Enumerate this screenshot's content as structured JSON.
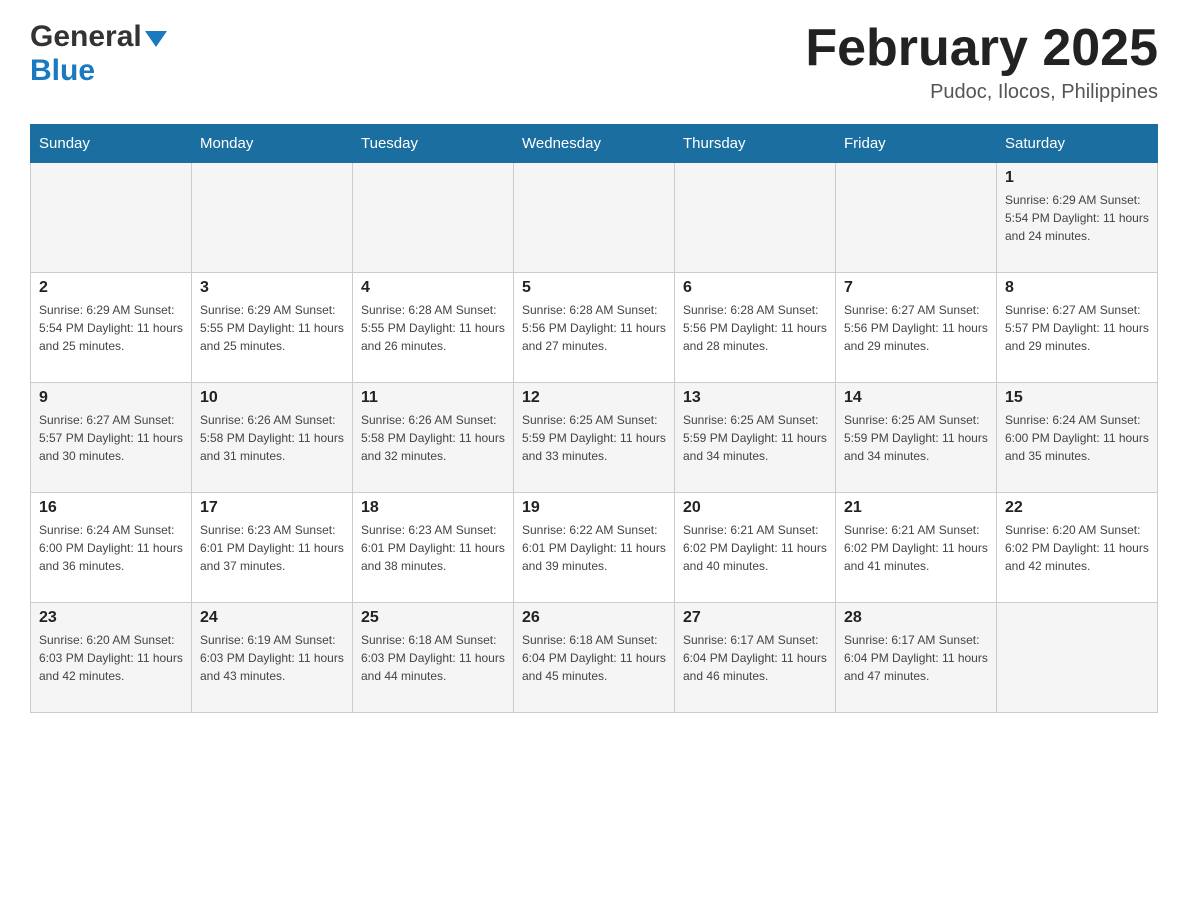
{
  "header": {
    "logo_general": "General",
    "logo_blue": "Blue",
    "month_title": "February 2025",
    "location": "Pudoc, Ilocos, Philippines"
  },
  "days_of_week": [
    "Sunday",
    "Monday",
    "Tuesday",
    "Wednesday",
    "Thursday",
    "Friday",
    "Saturday"
  ],
  "weeks": [
    {
      "days": [
        {
          "number": "",
          "info": ""
        },
        {
          "number": "",
          "info": ""
        },
        {
          "number": "",
          "info": ""
        },
        {
          "number": "",
          "info": ""
        },
        {
          "number": "",
          "info": ""
        },
        {
          "number": "",
          "info": ""
        },
        {
          "number": "1",
          "info": "Sunrise: 6:29 AM\nSunset: 5:54 PM\nDaylight: 11 hours and 24 minutes."
        }
      ]
    },
    {
      "days": [
        {
          "number": "2",
          "info": "Sunrise: 6:29 AM\nSunset: 5:54 PM\nDaylight: 11 hours and 25 minutes."
        },
        {
          "number": "3",
          "info": "Sunrise: 6:29 AM\nSunset: 5:55 PM\nDaylight: 11 hours and 25 minutes."
        },
        {
          "number": "4",
          "info": "Sunrise: 6:28 AM\nSunset: 5:55 PM\nDaylight: 11 hours and 26 minutes."
        },
        {
          "number": "5",
          "info": "Sunrise: 6:28 AM\nSunset: 5:56 PM\nDaylight: 11 hours and 27 minutes."
        },
        {
          "number": "6",
          "info": "Sunrise: 6:28 AM\nSunset: 5:56 PM\nDaylight: 11 hours and 28 minutes."
        },
        {
          "number": "7",
          "info": "Sunrise: 6:27 AM\nSunset: 5:56 PM\nDaylight: 11 hours and 29 minutes."
        },
        {
          "number": "8",
          "info": "Sunrise: 6:27 AM\nSunset: 5:57 PM\nDaylight: 11 hours and 29 minutes."
        }
      ]
    },
    {
      "days": [
        {
          "number": "9",
          "info": "Sunrise: 6:27 AM\nSunset: 5:57 PM\nDaylight: 11 hours and 30 minutes."
        },
        {
          "number": "10",
          "info": "Sunrise: 6:26 AM\nSunset: 5:58 PM\nDaylight: 11 hours and 31 minutes."
        },
        {
          "number": "11",
          "info": "Sunrise: 6:26 AM\nSunset: 5:58 PM\nDaylight: 11 hours and 32 minutes."
        },
        {
          "number": "12",
          "info": "Sunrise: 6:25 AM\nSunset: 5:59 PM\nDaylight: 11 hours and 33 minutes."
        },
        {
          "number": "13",
          "info": "Sunrise: 6:25 AM\nSunset: 5:59 PM\nDaylight: 11 hours and 34 minutes."
        },
        {
          "number": "14",
          "info": "Sunrise: 6:25 AM\nSunset: 5:59 PM\nDaylight: 11 hours and 34 minutes."
        },
        {
          "number": "15",
          "info": "Sunrise: 6:24 AM\nSunset: 6:00 PM\nDaylight: 11 hours and 35 minutes."
        }
      ]
    },
    {
      "days": [
        {
          "number": "16",
          "info": "Sunrise: 6:24 AM\nSunset: 6:00 PM\nDaylight: 11 hours and 36 minutes."
        },
        {
          "number": "17",
          "info": "Sunrise: 6:23 AM\nSunset: 6:01 PM\nDaylight: 11 hours and 37 minutes."
        },
        {
          "number": "18",
          "info": "Sunrise: 6:23 AM\nSunset: 6:01 PM\nDaylight: 11 hours and 38 minutes."
        },
        {
          "number": "19",
          "info": "Sunrise: 6:22 AM\nSunset: 6:01 PM\nDaylight: 11 hours and 39 minutes."
        },
        {
          "number": "20",
          "info": "Sunrise: 6:21 AM\nSunset: 6:02 PM\nDaylight: 11 hours and 40 minutes."
        },
        {
          "number": "21",
          "info": "Sunrise: 6:21 AM\nSunset: 6:02 PM\nDaylight: 11 hours and 41 minutes."
        },
        {
          "number": "22",
          "info": "Sunrise: 6:20 AM\nSunset: 6:02 PM\nDaylight: 11 hours and 42 minutes."
        }
      ]
    },
    {
      "days": [
        {
          "number": "23",
          "info": "Sunrise: 6:20 AM\nSunset: 6:03 PM\nDaylight: 11 hours and 42 minutes."
        },
        {
          "number": "24",
          "info": "Sunrise: 6:19 AM\nSunset: 6:03 PM\nDaylight: 11 hours and 43 minutes."
        },
        {
          "number": "25",
          "info": "Sunrise: 6:18 AM\nSunset: 6:03 PM\nDaylight: 11 hours and 44 minutes."
        },
        {
          "number": "26",
          "info": "Sunrise: 6:18 AM\nSunset: 6:04 PM\nDaylight: 11 hours and 45 minutes."
        },
        {
          "number": "27",
          "info": "Sunrise: 6:17 AM\nSunset: 6:04 PM\nDaylight: 11 hours and 46 minutes."
        },
        {
          "number": "28",
          "info": "Sunrise: 6:17 AM\nSunset: 6:04 PM\nDaylight: 11 hours and 47 minutes."
        },
        {
          "number": "",
          "info": ""
        }
      ]
    }
  ]
}
